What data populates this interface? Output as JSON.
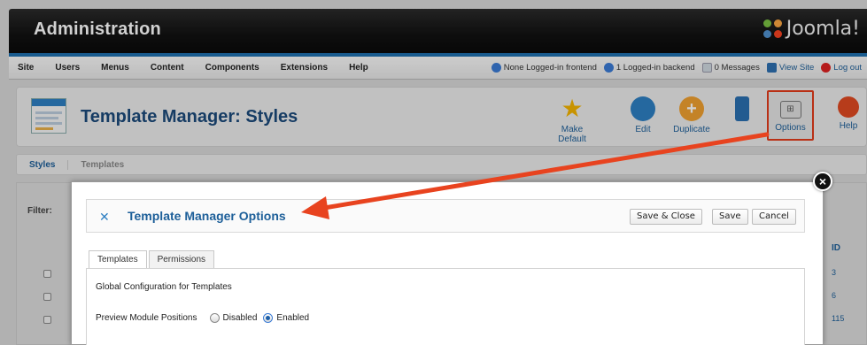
{
  "header": {
    "title": "Administration",
    "brand": "Joomla!"
  },
  "menubar": {
    "items": [
      "Site",
      "Users",
      "Menus",
      "Content",
      "Components",
      "Extensions",
      "Help"
    ],
    "status": {
      "frontend": "None Logged-in frontend",
      "backend": "1 Logged-in backend",
      "messages": "0 Messages",
      "view_site": "View Site",
      "logout": "Log out"
    }
  },
  "toolbar": {
    "page_title": "Template Manager: Styles",
    "buttons": {
      "make_default": "Make Default",
      "edit": "Edit",
      "duplicate": "Duplicate",
      "options": "Options",
      "help": "Help"
    }
  },
  "subnav": {
    "tabs": [
      "Styles",
      "Templates"
    ]
  },
  "background": {
    "filter_label": "Filter:",
    "id_header": "ID",
    "ids": [
      "3",
      "6",
      "115"
    ]
  },
  "modal": {
    "title": "Template Manager Options",
    "buttons": {
      "save_close": "Save & Close",
      "save": "Save",
      "cancel": "Cancel"
    },
    "tabs": [
      "Templates",
      "Permissions"
    ],
    "global_label": "Global Configuration for Templates",
    "preview_label": "Preview Module Positions",
    "options": {
      "disabled": "Disabled",
      "enabled": "Enabled",
      "selected": "Enabled"
    },
    "close_glyph": "×"
  },
  "colors": {
    "accent_blue": "#1d5f99",
    "highlight_red": "#e23b1a",
    "arrow_red": "#e8431f"
  }
}
